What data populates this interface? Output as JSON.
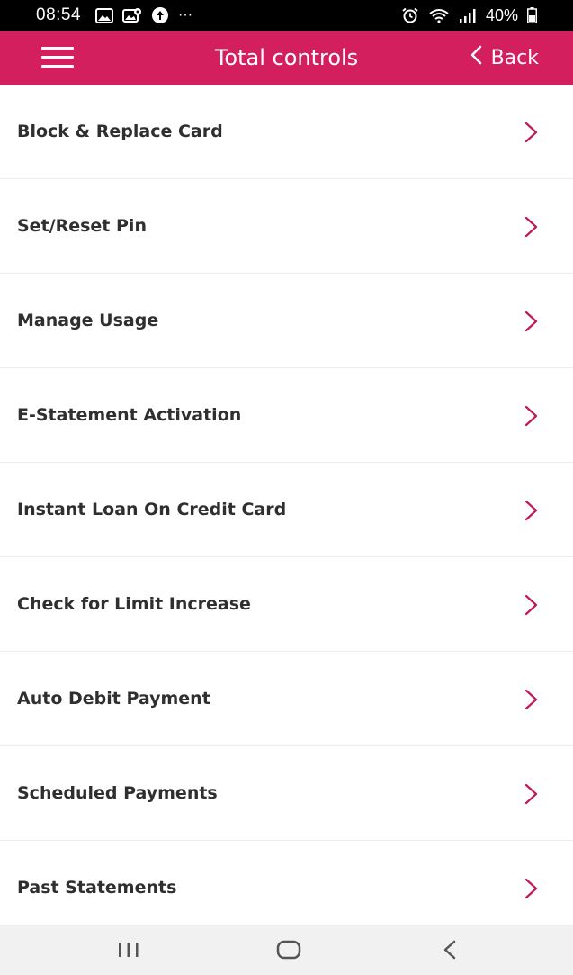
{
  "status_bar": {
    "time": "08:54",
    "more_indicator": "···",
    "battery_percent": "40%",
    "icons_left": [
      "gallery-icon",
      "photo-location-icon",
      "data-saver-icon"
    ],
    "icons_right": [
      "alarm-icon",
      "wifi-icon",
      "signal-icon",
      "battery-icon"
    ]
  },
  "app_bar": {
    "title": "Total controls",
    "back_label": "Back",
    "background_color": "#d41f5f",
    "menu_icon": "hamburger-icon"
  },
  "menu": {
    "chevron_color": "#c2185b",
    "items": [
      {
        "label": "Block & Replace Card"
      },
      {
        "label": "Set/Reset Pin"
      },
      {
        "label": "Manage Usage"
      },
      {
        "label": "E-Statement Activation"
      },
      {
        "label": "Instant Loan On Credit Card"
      },
      {
        "label": "Check for Limit Increase"
      },
      {
        "label": "Auto Debit Payment"
      },
      {
        "label": "Scheduled Payments"
      },
      {
        "label": "Past Statements"
      }
    ]
  },
  "nav_bar": {
    "buttons": [
      "recents-icon",
      "home-icon",
      "back-nav-icon"
    ]
  }
}
